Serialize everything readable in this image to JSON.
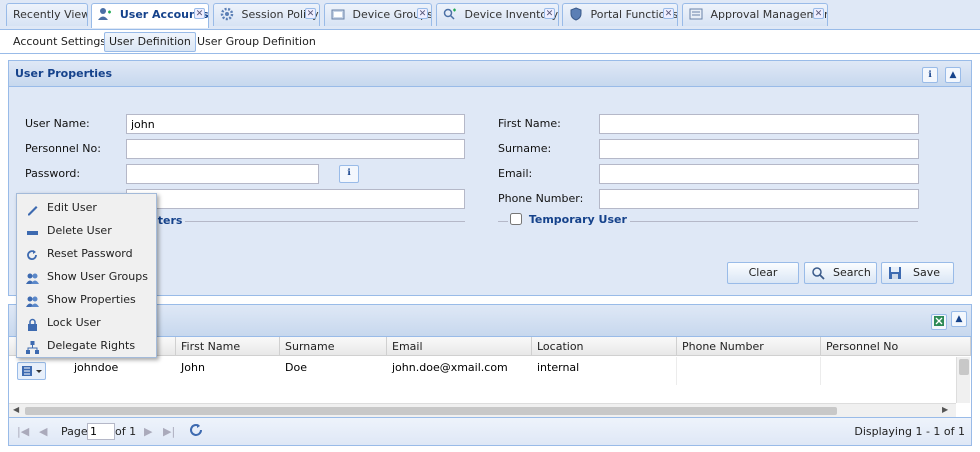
{
  "tabs": [
    {
      "label": "Recently View",
      "icon": "",
      "active": false,
      "closable": false
    },
    {
      "label": "User Accounts",
      "icon": "user-icon",
      "active": true,
      "closable": true
    },
    {
      "label": "Session Policy",
      "icon": "gear-icon",
      "active": false,
      "closable": true
    },
    {
      "label": "Device Groups",
      "icon": "folder-icon",
      "active": false,
      "closable": true
    },
    {
      "label": "Device Inventory",
      "icon": "device-search-icon",
      "active": false,
      "closable": true
    },
    {
      "label": "Portal Functions",
      "icon": "shield-icon",
      "active": false,
      "closable": true
    },
    {
      "label": "Approval Management",
      "icon": "approval-icon",
      "active": false,
      "closable": true
    }
  ],
  "subtabs": [
    "Account Settings",
    "User Definition",
    "User Group Definition"
  ],
  "subtab_selected": "User Definition",
  "panel": {
    "title": "User Properties",
    "fields": {
      "user_name": {
        "label": "User Name:",
        "value": "john"
      },
      "personnel_no": {
        "label": "Personnel No:",
        "value": ""
      },
      "password": {
        "label": "Password:",
        "value": ""
      },
      "first_name": {
        "label": "First Name:",
        "value": ""
      },
      "surname": {
        "label": "Surname:",
        "value": ""
      },
      "email": {
        "label": "Email:",
        "value": ""
      },
      "phone": {
        "label": "Phone Number:",
        "value": ""
      }
    },
    "filters_label": "lters",
    "temporary_user": {
      "label": "Temporary User",
      "checked": false
    },
    "buttons": {
      "clear": "Clear",
      "search": "Search",
      "save": "Save"
    }
  },
  "context_menu": [
    {
      "label": "Edit User",
      "icon": "pencil-icon"
    },
    {
      "label": "Delete User",
      "icon": "delete-icon"
    },
    {
      "label": "Reset Password",
      "icon": "reset-icon"
    },
    {
      "label": "Show User Groups",
      "icon": "group-icon"
    },
    {
      "label": "Show Properties",
      "icon": "properties-icon"
    },
    {
      "label": "Lock User",
      "icon": "lock-icon"
    },
    {
      "label": "Delegate Rights",
      "icon": "delegate-icon"
    }
  ],
  "grid": {
    "columns": [
      "First Name",
      "Surname",
      "Email",
      "Location",
      "Phone Number",
      "Personnel No"
    ],
    "rows": [
      {
        "user_name": "johndoe",
        "first_name": "John",
        "surname": "Doe",
        "email": "john.doe@xmail.com",
        "location": "internal",
        "phone": "",
        "personnel_no": ""
      }
    ]
  },
  "pager": {
    "page_label": "Page",
    "page_value": "1",
    "of_label": "of 1",
    "displaying": "Displaying 1 - 1 of 1"
  },
  "colors": {
    "accent": "#15428b",
    "border": "#99bbe8",
    "panel_bg": "#dfe8f6"
  }
}
